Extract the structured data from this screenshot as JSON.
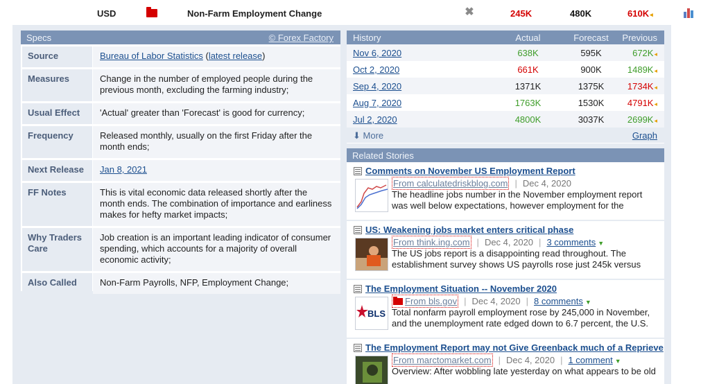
{
  "event": {
    "currency": "USD",
    "impact_icon": "high-impact-red-folder-icon",
    "impact_color": "#d40000",
    "name": "Non-Farm Employment Change",
    "close_icon": "close-icon",
    "actual": "245K",
    "forecast": "480K",
    "previous": "610K",
    "previous_marker": "◂",
    "chart_icon": "bar-chart-icon"
  },
  "specs": {
    "header": "Specs",
    "header_link": "© Forex Factory",
    "rows": [
      {
        "label": "Source",
        "value_link": "Bureau of Labor Statistics",
        "value_mid": " (",
        "value_link2": "latest release",
        "value_end": ")"
      },
      {
        "label": "Measures",
        "value": "Change in the number of employed people during the previous month, excluding the farming industry;"
      },
      {
        "label": "Usual Effect",
        "value": "'Actual' greater than 'Forecast' is good for currency;"
      },
      {
        "label": "Frequency",
        "value": "Released monthly, usually on the first Friday after the month ends;"
      },
      {
        "label": "Next Release",
        "value_link": "Jan 8, 2021"
      },
      {
        "label": "FF Notes",
        "value": "This is vital economic data released shortly after the month ends. The combination of importance and earliness makes for hefty market impacts;"
      },
      {
        "label": "Why Traders Care",
        "value": "Job creation is an important leading indicator of consumer spending, which accounts for a majority of overall economic activity;"
      },
      {
        "label": "Also Called",
        "value": "Non-Farm Payrolls, NFP, Employment Change;"
      }
    ]
  },
  "history": {
    "header": {
      "date": "History",
      "actual": "Actual",
      "forecast": "Forecast",
      "previous": "Previous"
    },
    "rows": [
      {
        "date": "Nov 6, 2020",
        "actual": "638K",
        "forecast": "595K",
        "previous": "672K"
      },
      {
        "date": "Oct 2, 2020",
        "actual": "661K",
        "forecast": "900K",
        "previous": "1489K"
      },
      {
        "date": "Sep 4, 2020",
        "actual": "1371K",
        "forecast": "1375K",
        "previous": "1734K"
      },
      {
        "date": "Aug 7, 2020",
        "actual": "1763K",
        "forecast": "1530K",
        "previous": "4791K"
      },
      {
        "date": "Jul 2, 2020",
        "actual": "4800K",
        "forecast": "3037K",
        "previous": "2699K"
      }
    ],
    "more": "More",
    "more_icon": "down-arrow-icon",
    "graph": "Graph",
    "colors": {
      "good": "#3f9d2a",
      "bad": "#d40000",
      "marker": "#e6a000"
    }
  },
  "related": {
    "header": "Related Stories",
    "stories": [
      {
        "title": "Comments on November US Employment Report",
        "source": "From calculatedriskblog.com",
        "date": "Dec 4, 2020",
        "comments": "",
        "excerpt": "The headline jobs number in the November employment report was well below expectations, however employment for the",
        "thumb_icon": "line-chart-thumbnail"
      },
      {
        "title": "US: Weakening jobs market enters critical phase",
        "source": "From think.ing.com",
        "date": "Dec 4, 2020",
        "comments": "3 comments",
        "excerpt": "The US jobs report is a disappointing read throughout. The establishment survey shows US payrolls rose just 245k versus",
        "thumb_icon": "worker-photo-thumbnail"
      },
      {
        "title": "The Employment Situation -- November 2020",
        "source": "From bls.gov",
        "date": "Dec 4, 2020",
        "comments": "8 comments",
        "excerpt": "Total nonfarm payroll employment rose by 245,000 in November, and the unemployment rate edged down to 6.7 percent, the U.S.",
        "thumb_icon": "bls-logo-thumbnail",
        "thumb_text": "BLS"
      },
      {
        "title": "The Employment Report may not Give Greenback much of a Reprieve",
        "source": "From marctomarket.com",
        "date": "Dec 4, 2020",
        "comments": "1 comment",
        "excerpt": "Overview: After wobbling late yesterday on what appears to be old",
        "thumb_icon": "photo-thumbnail"
      }
    ]
  }
}
